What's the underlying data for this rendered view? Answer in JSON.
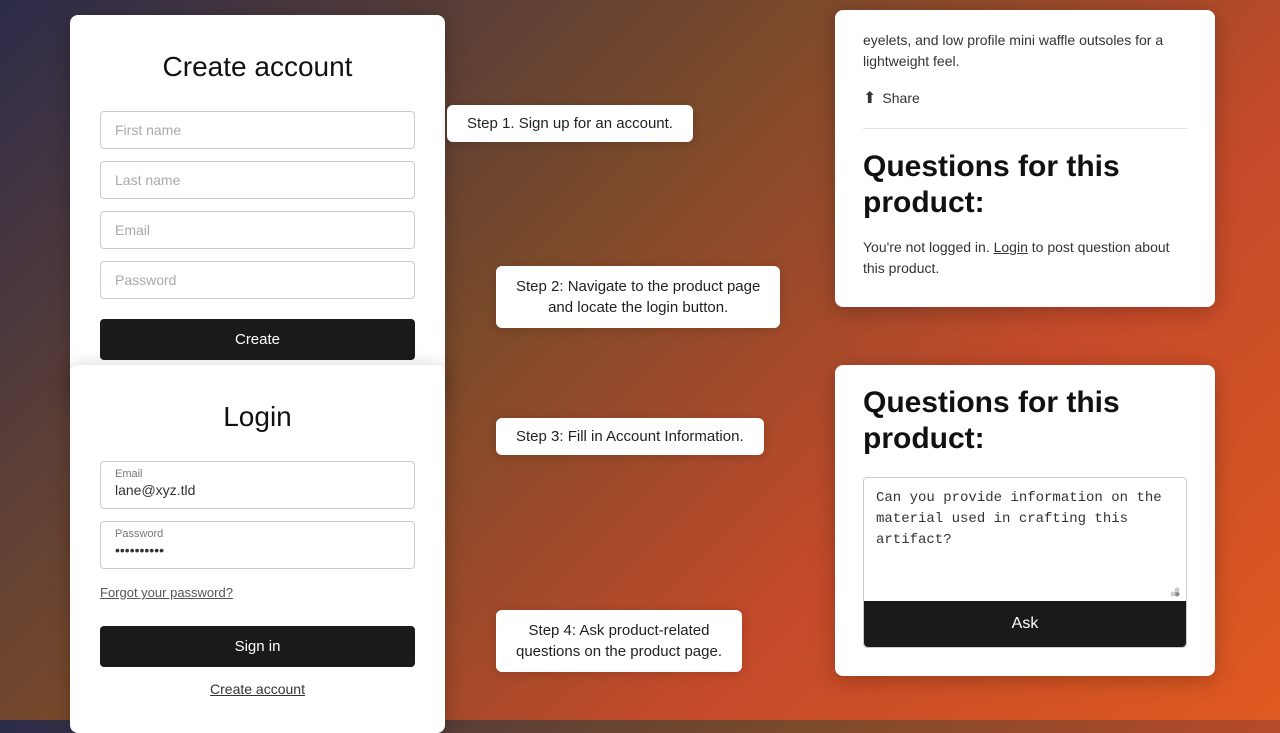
{
  "create_account_card": {
    "title": "Create account",
    "fields": [
      {
        "placeholder": "First name",
        "type": "text",
        "name": "first-name-input"
      },
      {
        "placeholder": "Last name",
        "type": "text",
        "name": "last-name-input"
      },
      {
        "placeholder": "Email",
        "type": "email",
        "name": "email-input"
      },
      {
        "placeholder": "Password",
        "type": "password",
        "name": "password-input"
      }
    ],
    "create_button_label": "Create"
  },
  "login_card": {
    "title": "Login",
    "email_label": "Email",
    "email_value": "lane@xyz.tld",
    "password_label": "Password",
    "password_value": "••••••••••",
    "forgot_password_label": "Forgot your password?",
    "signin_button_label": "Sign in",
    "create_account_link_label": "Create account"
  },
  "steps": [
    {
      "label": "Step 1. Sign up for an account.",
      "name": "step-1"
    },
    {
      "line1": "Step 2: Navigate to the product page",
      "line2": "and locate the login button.",
      "name": "step-2"
    },
    {
      "label": "Step 3: Fill in Account Information.",
      "name": "step-3"
    },
    {
      "line1": "Step 4: Ask product-related",
      "line2": "questions on the product page.",
      "name": "step-4"
    }
  ],
  "product_card_top": {
    "body_text": "eyelets, and low profile mini waffle outsoles for a lightweight feel.",
    "share_label": "Share",
    "section_title_line1": "Questions for this",
    "section_title_line2": "product:",
    "not_logged_text": "You're not logged in.",
    "login_link_label": "Login",
    "post_question_text": "to post question about this product."
  },
  "product_card_bottom": {
    "section_title_line1": "Questions for this",
    "section_title_line2": "product:",
    "question_placeholder": "Can you provide information on the material used in crafting this artifact?",
    "ask_button_label": "Ask"
  }
}
